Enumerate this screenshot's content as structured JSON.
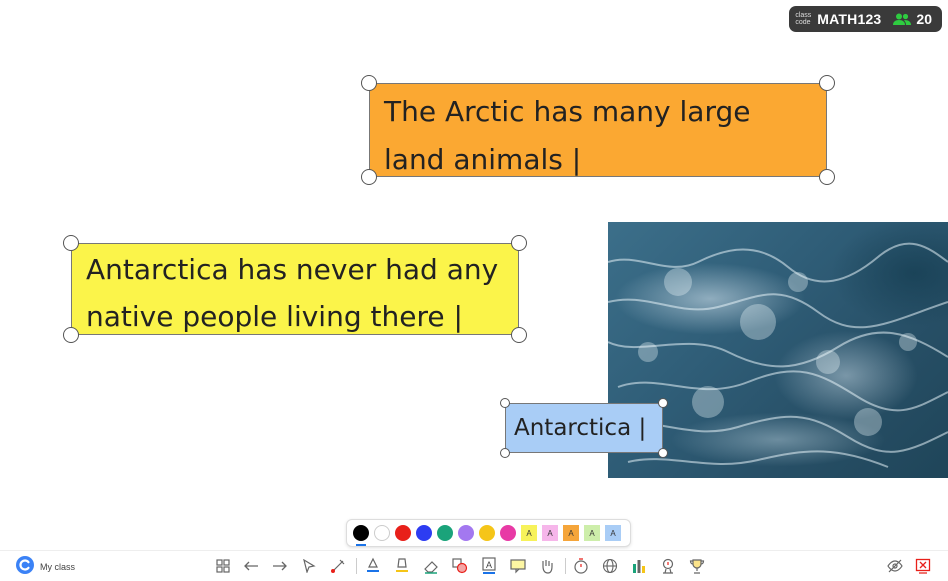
{
  "class_code": {
    "caption_line1": "class",
    "caption_line2": "code",
    "code": "MATH123",
    "participants": "20",
    "participants_color": "#2ecc40"
  },
  "notes": [
    {
      "text": "The Arctic has many large land animals |",
      "color": "#fba832"
    },
    {
      "text": "Antarctica has never had any native people living there |",
      "color": "#fbf44a"
    },
    {
      "text": "Antarctica |",
      "color": "#a9cdf6"
    }
  ],
  "palette": {
    "pen_colors": [
      "#000000",
      "#ffffff",
      "#e8201a",
      "#2d3cf2",
      "#1aa37a",
      "#a378f0",
      "#f5c518",
      "#e83aa5"
    ],
    "highlight_label": "A",
    "highlight_colors": [
      "#f7f25a",
      "#f6b6ea",
      "#f5a53a",
      "#cdeeaa",
      "#a9cdf6"
    ],
    "selected": "black"
  },
  "toolbar": {
    "brand_label": "My class",
    "tools": [
      "grid-icon",
      "undo-icon",
      "redo-icon",
      "select-icon",
      "laser-icon",
      "pen-icon",
      "highlighter-icon",
      "eraser-icon",
      "shapes-icon",
      "text-icon",
      "sticky-note-icon",
      "hand-icon",
      "timer-icon",
      "web-icon",
      "chart-icon",
      "screen-icon",
      "trophy-icon",
      "hide-icon",
      "close-board-icon"
    ],
    "accent": "#1a73e8"
  }
}
